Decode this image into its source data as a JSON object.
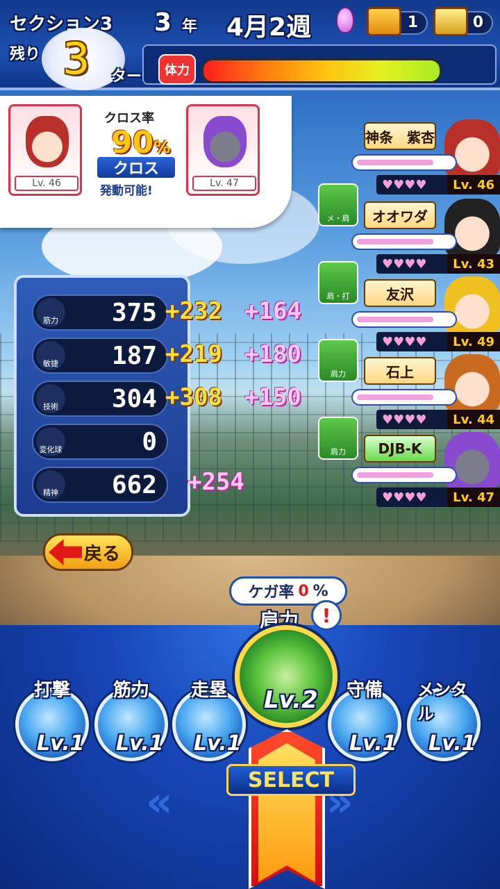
{
  "header": {
    "section": "セクション3",
    "year_num": "3",
    "year_unit": "年",
    "date": "4月2週",
    "remaining_label": "残り",
    "remaining_turns": "3",
    "turn_label": "ターン",
    "stamina_label": "体力",
    "stamina_level": 0.95,
    "chest_red_count": "1",
    "chest_gold_count": "0"
  },
  "cross": {
    "rate_label": "クロス率",
    "rate_value": "90",
    "rate_unit": "%",
    "button_label": "クロス",
    "status": "発動可能!",
    "left_lv": "Lv. 46",
    "right_lv": "Lv. 47"
  },
  "stats": [
    {
      "label": "筋力",
      "value": "375",
      "bonus1": "+232",
      "bonus2": "+164"
    },
    {
      "label": "敏捷",
      "value": "187",
      "bonus1": "+219",
      "bonus2": "+180"
    },
    {
      "label": "技術",
      "value": "304",
      "bonus1": "+308",
      "bonus2": "+150"
    },
    {
      "label": "変化球",
      "value": "0",
      "bonus1": "",
      "bonus2": ""
    },
    {
      "label": "精神",
      "value": "662",
      "bonus1": "",
      "bonus2": "+254"
    }
  ],
  "back_label": "戻る",
  "characters": [
    {
      "name": "神条　紫杏",
      "tag": "",
      "lv": "Lv. 46",
      "hearts": "♥♥♥♥"
    },
    {
      "name": "オオワダ",
      "tag": "メ・肩",
      "lv": "Lv. 43",
      "hearts": "♥♥♥♥"
    },
    {
      "name": "友沢",
      "tag": "肩・打",
      "lv": "Lv. 49",
      "hearts": "♥♥♥♥"
    },
    {
      "name": "石上",
      "tag": "肩力",
      "lv": "Lv. 44",
      "hearts": "♥♥♥♥"
    },
    {
      "name": "DJB-K",
      "tag": "肩力",
      "lv": "Lv. 47",
      "hearts": "♥♥♥♥"
    }
  ],
  "injury": {
    "label": "ケガ率",
    "value": "0",
    "unit": "%"
  },
  "selected_skill": {
    "name": "肩力",
    "lv": "Lv.2"
  },
  "skills": [
    {
      "name": "打撃",
      "lv": "Lv.1"
    },
    {
      "name": "筋力",
      "lv": "Lv.1"
    },
    {
      "name": "走塁",
      "lv": "Lv.1"
    },
    {
      "name": "守備",
      "lv": "Lv.1"
    },
    {
      "name": "メンタル",
      "lv": "Lv.1"
    }
  ],
  "select_label": "SELECT"
}
